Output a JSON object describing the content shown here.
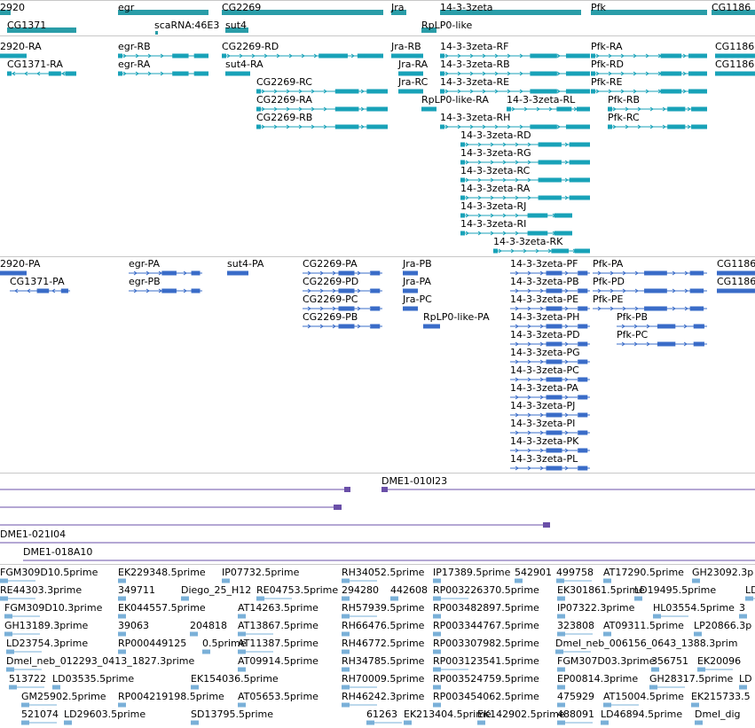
{
  "colors": {
    "gene": "#2a9da8",
    "transcript": "#18a2b8",
    "cds": "#3a6cc8",
    "clone": "#6a4fa8",
    "est": "#7ab0d8"
  },
  "genes": [
    {
      "label": "2920"
    },
    {
      "label": "egr"
    },
    {
      "label": "CG2269"
    },
    {
      "label": "Jra"
    },
    {
      "label": "14-3-3zeta"
    },
    {
      "label": "Pfk"
    },
    {
      "label": "CG1186"
    },
    {
      "label": "CG1371"
    },
    {
      "label": "scaRNA:46E3"
    },
    {
      "label": "sut4"
    },
    {
      "label": "RpLP0-like"
    }
  ],
  "transcripts": [
    {
      "label": "2920-RA"
    },
    {
      "label": "egr-RB"
    },
    {
      "label": "CG2269-RD"
    },
    {
      "label": "Jra-RB"
    },
    {
      "label": "14-3-3zeta-RF"
    },
    {
      "label": "Pfk-RA"
    },
    {
      "label": "CG1186"
    },
    {
      "label": "CG1371-RA"
    },
    {
      "label": "egr-RA"
    },
    {
      "label": "sut4-RA"
    },
    {
      "label": "Jra-RA"
    },
    {
      "label": "14-3-3zeta-RB"
    },
    {
      "label": "Pfk-RD"
    },
    {
      "label": "CG1186"
    },
    {
      "label": "CG2269-RC"
    },
    {
      "label": "Jra-RC"
    },
    {
      "label": "14-3-3zeta-RE"
    },
    {
      "label": "Pfk-RE"
    },
    {
      "label": "CG2269-RA"
    },
    {
      "label": "RpLP0-like-RA"
    },
    {
      "label": "14-3-3zeta-RL"
    },
    {
      "label": "Pfk-RB"
    },
    {
      "label": "CG2269-RB"
    },
    {
      "label": "14-3-3zeta-RH"
    },
    {
      "label": "Pfk-RC"
    },
    {
      "label": "14-3-3zeta-RD"
    },
    {
      "label": "14-3-3zeta-RG"
    },
    {
      "label": "14-3-3zeta-RC"
    },
    {
      "label": "14-3-3zeta-RA"
    },
    {
      "label": "14-3-3zeta-RJ"
    },
    {
      "label": "14-3-3zeta-RI"
    },
    {
      "label": "14-3-3zeta-RK"
    }
  ],
  "cds": [
    {
      "label": "2920-PA"
    },
    {
      "label": "egr-PA"
    },
    {
      "label": "sut4-PA"
    },
    {
      "label": "CG2269-PA"
    },
    {
      "label": "Jra-PB"
    },
    {
      "label": "14-3-3zeta-PF"
    },
    {
      "label": "Pfk-PA"
    },
    {
      "label": "CG1186"
    },
    {
      "label": "CG1371-PA"
    },
    {
      "label": "egr-PB"
    },
    {
      "label": "CG2269-PD"
    },
    {
      "label": "Jra-PA"
    },
    {
      "label": "14-3-3zeta-PB"
    },
    {
      "label": "Pfk-PD"
    },
    {
      "label": "CG1186"
    },
    {
      "label": "CG2269-PC"
    },
    {
      "label": "Jra-PC"
    },
    {
      "label": "14-3-3zeta-PE"
    },
    {
      "label": "Pfk-PE"
    },
    {
      "label": "CG2269-PB"
    },
    {
      "label": "RpLP0-like-PA"
    },
    {
      "label": "14-3-3zeta-PH"
    },
    {
      "label": "14-3-3zeta-PD"
    },
    {
      "label": "Pfk-PB"
    },
    {
      "label": "Pfk-PC"
    },
    {
      "label": "14-3-3zeta-PG"
    },
    {
      "label": "14-3-3zeta-PC"
    },
    {
      "label": "14-3-3zeta-PA"
    },
    {
      "label": "14-3-3zeta-PJ"
    },
    {
      "label": "14-3-3zeta-PI"
    },
    {
      "label": "14-3-3zeta-PK"
    },
    {
      "label": "14-3-3zeta-PL"
    }
  ],
  "clones": [
    {
      "label": "DME1-010I23"
    },
    {
      "label": "DME1-021I04"
    },
    {
      "label": "DME1-018A10"
    }
  ],
  "ests": [
    {
      "label": "FGM309D10.5prime"
    },
    {
      "label": "EK229348.5prime"
    },
    {
      "label": "IP07732.5prime"
    },
    {
      "label": "RH34052.5prime"
    },
    {
      "label": "IP17389.5prime"
    },
    {
      "label": "542901"
    },
    {
      "label": "499758"
    },
    {
      "label": "AT17290.5prime"
    },
    {
      "label": "GH23092.3p"
    },
    {
      "label": "RE44303.3prime"
    },
    {
      "label": "349711"
    },
    {
      "label": "Diego_25_H12"
    },
    {
      "label": "RE04753.5prime"
    },
    {
      "label": "294280"
    },
    {
      "label": "442608"
    },
    {
      "label": "RP003226370.5prime"
    },
    {
      "label": "EK301861.5prime"
    },
    {
      "label": "LD19495.5prime"
    },
    {
      "label": "LD"
    },
    {
      "label": "FGM309D10.3prime"
    },
    {
      "label": "EK044557.5prime"
    },
    {
      "label": "AT14263.5prime"
    },
    {
      "label": "RH57939.5prime"
    },
    {
      "label": "RP003482897.5prime"
    },
    {
      "label": "IP07322.3prime"
    },
    {
      "label": "HL03554.5prime"
    },
    {
      "label": "3"
    },
    {
      "label": "GH13189.3prime"
    },
    {
      "label": "39063"
    },
    {
      "label": "204818"
    },
    {
      "label": "AT13867.5prime"
    },
    {
      "label": "RH66476.5prime"
    },
    {
      "label": "RP003344767.5prime"
    },
    {
      "label": "323808"
    },
    {
      "label": "AT09311.5prime"
    },
    {
      "label": "LP20866.3p"
    },
    {
      "label": "LD23754.3prime"
    },
    {
      "label": "RP000449125"
    },
    {
      "label": "0.5prime"
    },
    {
      "label": "AT11387.5prime"
    },
    {
      "label": "RH46772.5prime"
    },
    {
      "label": "RP003307982.5prime"
    },
    {
      "label": "Dmel_neb_006156_0643_1388.3prim"
    },
    {
      "label": "Dmel_neb_012293_0413_1827.3prime"
    },
    {
      "label": "AT09914.5prime"
    },
    {
      "label": "RH34785.5prime"
    },
    {
      "label": "RP003123541.5prime"
    },
    {
      "label": "FGM307D03.3prime"
    },
    {
      "label": "356751"
    },
    {
      "label": "EK20096"
    },
    {
      "label": "513722"
    },
    {
      "label": "LD03535.5prime"
    },
    {
      "label": "EK154036.5prime"
    },
    {
      "label": "RH70009.5prime"
    },
    {
      "label": "RP003524759.5prime"
    },
    {
      "label": "EP00814.3prime"
    },
    {
      "label": "GH28317.5prime"
    },
    {
      "label": "LD"
    },
    {
      "label": "GM25902.5prime"
    },
    {
      "label": "RP004219198.5prime"
    },
    {
      "label": "AT05653.5prime"
    },
    {
      "label": "RH46242.3prime"
    },
    {
      "label": "RP003454062.5prime"
    },
    {
      "label": "475929"
    },
    {
      "label": "AT15004.5prime"
    },
    {
      "label": "EK215733.5"
    },
    {
      "label": "521074"
    },
    {
      "label": "LD29603.5prime"
    },
    {
      "label": "SD13795.5prime"
    },
    {
      "label": "61263"
    },
    {
      "label": "EK213404.5prime"
    },
    {
      "label": "EK142902.5prime"
    },
    {
      "label": "488091"
    },
    {
      "label": "LD46894.5prime"
    },
    {
      "label": "Dmel_dig"
    }
  ]
}
